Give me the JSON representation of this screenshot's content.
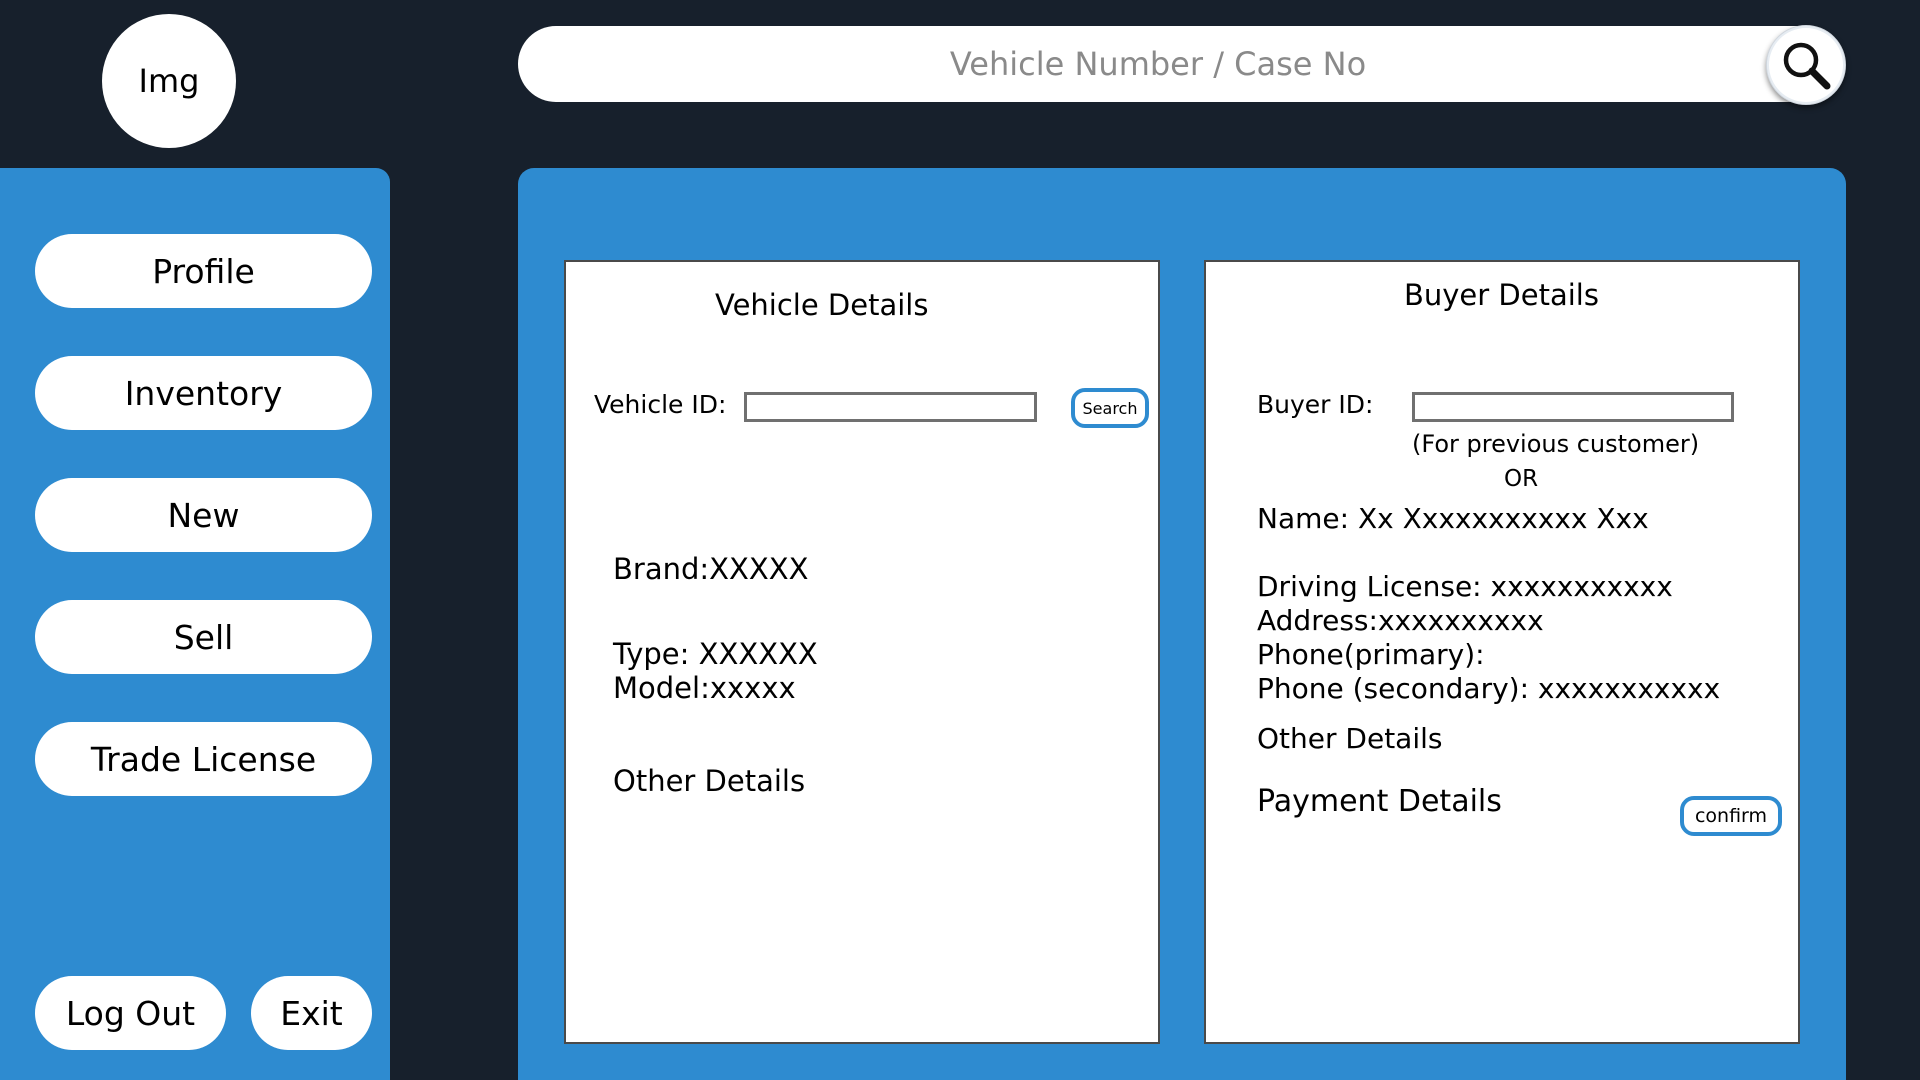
{
  "avatar": {
    "label": "Img"
  },
  "search": {
    "placeholder": "Vehicle Number / Case No",
    "icon": "magnifier-icon"
  },
  "sidebar": {
    "items": [
      {
        "label": "Profile"
      },
      {
        "label": "Inventory"
      },
      {
        "label": "New"
      },
      {
        "label": "Sell"
      },
      {
        "label": "Trade License"
      }
    ],
    "logout_label": "Log Out",
    "exit_label": "Exit"
  },
  "vehicle": {
    "title": "Vehicle Details",
    "id_label": "Vehicle  ID:",
    "id_value": "",
    "search_label": "Search",
    "brand": "Brand:XXXXX",
    "type": "Type: XXXXXX",
    "model": "Model:xxxxx",
    "other": "Other Details"
  },
  "buyer": {
    "title": "Buyer Details",
    "id_label": "Buyer ID:",
    "id_value": "",
    "hint": "(For previous customer)",
    "or": "OR",
    "name": "Name: Xx Xxxxxxxxxxx Xxx",
    "license": "Driving License: xxxxxxxxxxx",
    "address": "Address:xxxxxxxxxx",
    "phone_primary": "Phone(primary):",
    "phone_secondary": "Phone (secondary): xxxxxxxxxxx",
    "other": "Other Details",
    "payment": "Payment Details",
    "confirm_label": "confirm"
  },
  "colors": {
    "background": "#17202c",
    "panel": "#2e8bd0",
    "card": "#ffffff"
  }
}
